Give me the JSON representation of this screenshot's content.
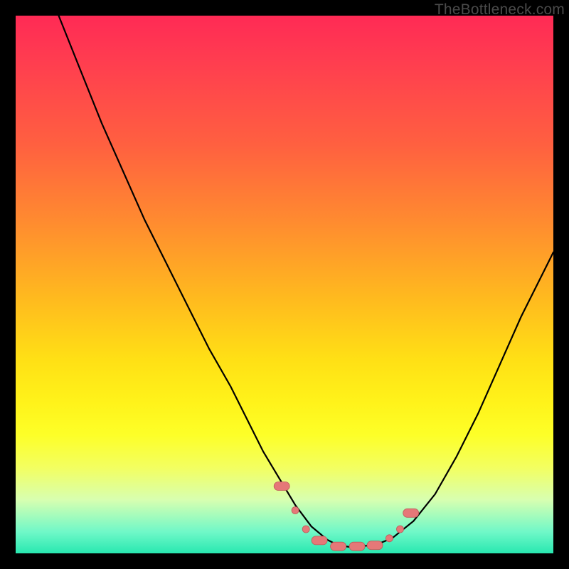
{
  "watermark": "TheBottleneck.com",
  "colors": {
    "frame": "#000000",
    "curve": "#000000",
    "pill_fill": "#e57878",
    "pill_stroke": "#be5a5a",
    "gradient_top": "#ff2a55",
    "gradient_bottom": "#28e8b0"
  },
  "chart_data": {
    "type": "line",
    "title": "",
    "xlabel": "",
    "ylabel": "",
    "xlim": [
      0,
      100
    ],
    "ylim": [
      0,
      100
    ],
    "grid": false,
    "legend": false,
    "annotation": "Heat-gradient background (red→green) with a single V-shaped black curve; small pink rounded markers clustered near the curve’s minimum.",
    "series": [
      {
        "name": "bottleneck-curve",
        "x": [
          8,
          12,
          16,
          20,
          24,
          28,
          32,
          36,
          40,
          43,
          46,
          49,
          52,
          55,
          58,
          60,
          62,
          64,
          67,
          70,
          74,
          78,
          82,
          86,
          90,
          94,
          98,
          100
        ],
        "values": [
          100,
          90,
          80,
          71,
          62,
          54,
          46,
          38,
          31,
          25,
          19,
          14,
          9,
          5,
          2.5,
          1.5,
          1.2,
          1.3,
          1.6,
          2.8,
          6,
          11,
          18,
          26,
          35,
          44,
          52,
          56
        ]
      }
    ],
    "markers": [
      {
        "x": 49.5,
        "y": 12.5,
        "kind": "pill-large"
      },
      {
        "x": 52.0,
        "y": 8.0,
        "kind": "pill-small"
      },
      {
        "x": 54.0,
        "y": 4.5,
        "kind": "pill-small"
      },
      {
        "x": 56.5,
        "y": 2.4,
        "kind": "pill-large"
      },
      {
        "x": 60.0,
        "y": 1.3,
        "kind": "pill-large"
      },
      {
        "x": 63.5,
        "y": 1.3,
        "kind": "pill-large"
      },
      {
        "x": 66.8,
        "y": 1.5,
        "kind": "pill-large"
      },
      {
        "x": 69.5,
        "y": 2.8,
        "kind": "pill-small"
      },
      {
        "x": 71.5,
        "y": 4.5,
        "kind": "pill-small"
      },
      {
        "x": 73.5,
        "y": 7.5,
        "kind": "pill-large"
      }
    ]
  }
}
